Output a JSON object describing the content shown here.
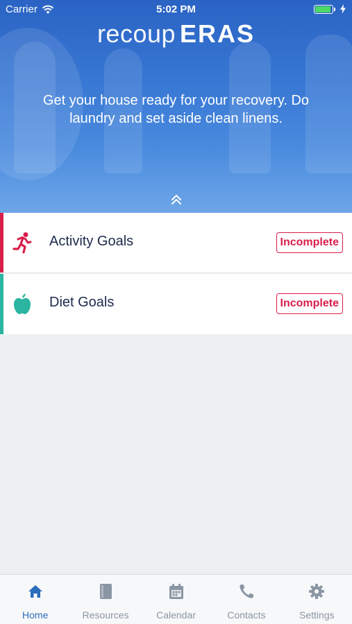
{
  "status_bar": {
    "carrier": "Carrier",
    "time": "5:02 PM",
    "battery_level": 0.9
  },
  "app": {
    "logo_light": "recoup",
    "logo_bold": "ERAS"
  },
  "hero": {
    "message": "Get your house ready for your recovery. Do laundry and set aside clean linens.",
    "collapse_icon": "double-chevron-up-icon"
  },
  "goals": [
    {
      "label": "Activity Goals",
      "status": "Incomplete",
      "icon": "running-person-icon",
      "accent": "#d81e4a"
    },
    {
      "label": "Diet Goals",
      "status": "Incomplete",
      "icon": "apple-icon",
      "accent": "#2bb5a0"
    }
  ],
  "tabs": [
    {
      "label": "Home",
      "icon": "home-icon",
      "active": true
    },
    {
      "label": "Resources",
      "icon": "book-icon",
      "active": false
    },
    {
      "label": "Calendar",
      "icon": "calendar-icon",
      "active": false
    },
    {
      "label": "Contacts",
      "icon": "phone-icon",
      "active": false
    },
    {
      "label": "Settings",
      "icon": "gear-icon",
      "active": false
    }
  ],
  "colors": {
    "primary": "#2a6ebd",
    "alert": "#d81e4a",
    "diet": "#2bb5a0",
    "text": "#1d2a4c"
  }
}
